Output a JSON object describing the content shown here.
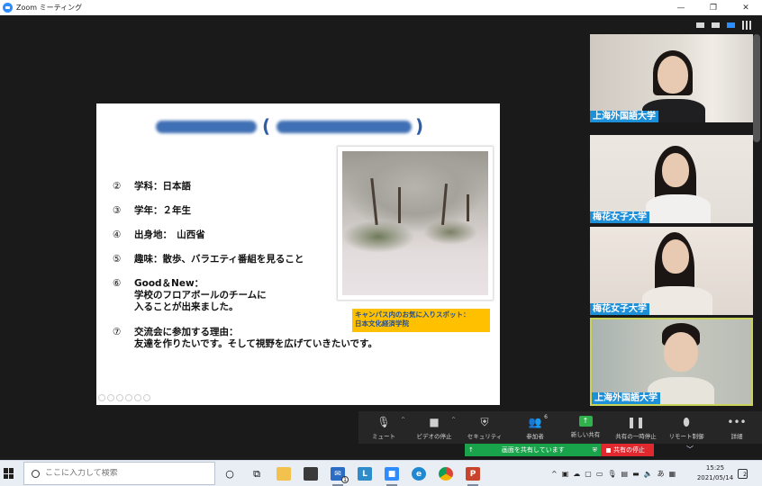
{
  "window": {
    "title": "Zoom ミーティング",
    "controls": [
      "—",
      "❐",
      "✕"
    ]
  },
  "slide": {
    "list": [
      {
        "num": "②",
        "text": "学科：日本語"
      },
      {
        "num": "③",
        "text": "学年：２年生"
      },
      {
        "num": "④",
        "text": "出身地：　山西省"
      },
      {
        "num": "⑤",
        "text": "趣味：散歩、バラエティ番組を見ること"
      },
      {
        "num": "⑥",
        "text": "Good＆New：\n学校のフロアボールのチームに\n入ることが出来ました。"
      },
      {
        "num": "⑦",
        "text": "交流会に参加する理由：\n友達を作りたいです。そして視野を広げていきたいです。"
      }
    ],
    "photo_caption_line1": "キャンパス内のお気に入りスポット：",
    "photo_caption_line2": "日本文化経済学院"
  },
  "participants": [
    {
      "name": "上海外国語大学"
    },
    {
      "name": "梅花女子大学"
    },
    {
      "name": "梅花女子大学"
    },
    {
      "name": "上海外国語大学"
    }
  ],
  "meeting_controls": {
    "mute": "ミュート",
    "video": "ビデオの停止",
    "security": "セキュリティ",
    "participants": "参加者",
    "participants_count": "6",
    "new_share": "新しい共有",
    "pause_share": "共有の一時停止",
    "remote_control": "リモート制御",
    "more": "詳細"
  },
  "share_bar": {
    "status": "画面を共有しています",
    "stop": "共有の停止"
  },
  "taskbar": {
    "search_placeholder": "ここに入力して検索",
    "mail_badge": "1",
    "time": "15:25",
    "date": "2021/05/14",
    "ime": "あ",
    "notification_count": "2"
  },
  "colors": {
    "accent": "#2d8cff",
    "share_green": "#19a34a",
    "stop_red": "#e0282f",
    "name_tag": "#1e90d8",
    "caption_bg": "#ffc000"
  }
}
